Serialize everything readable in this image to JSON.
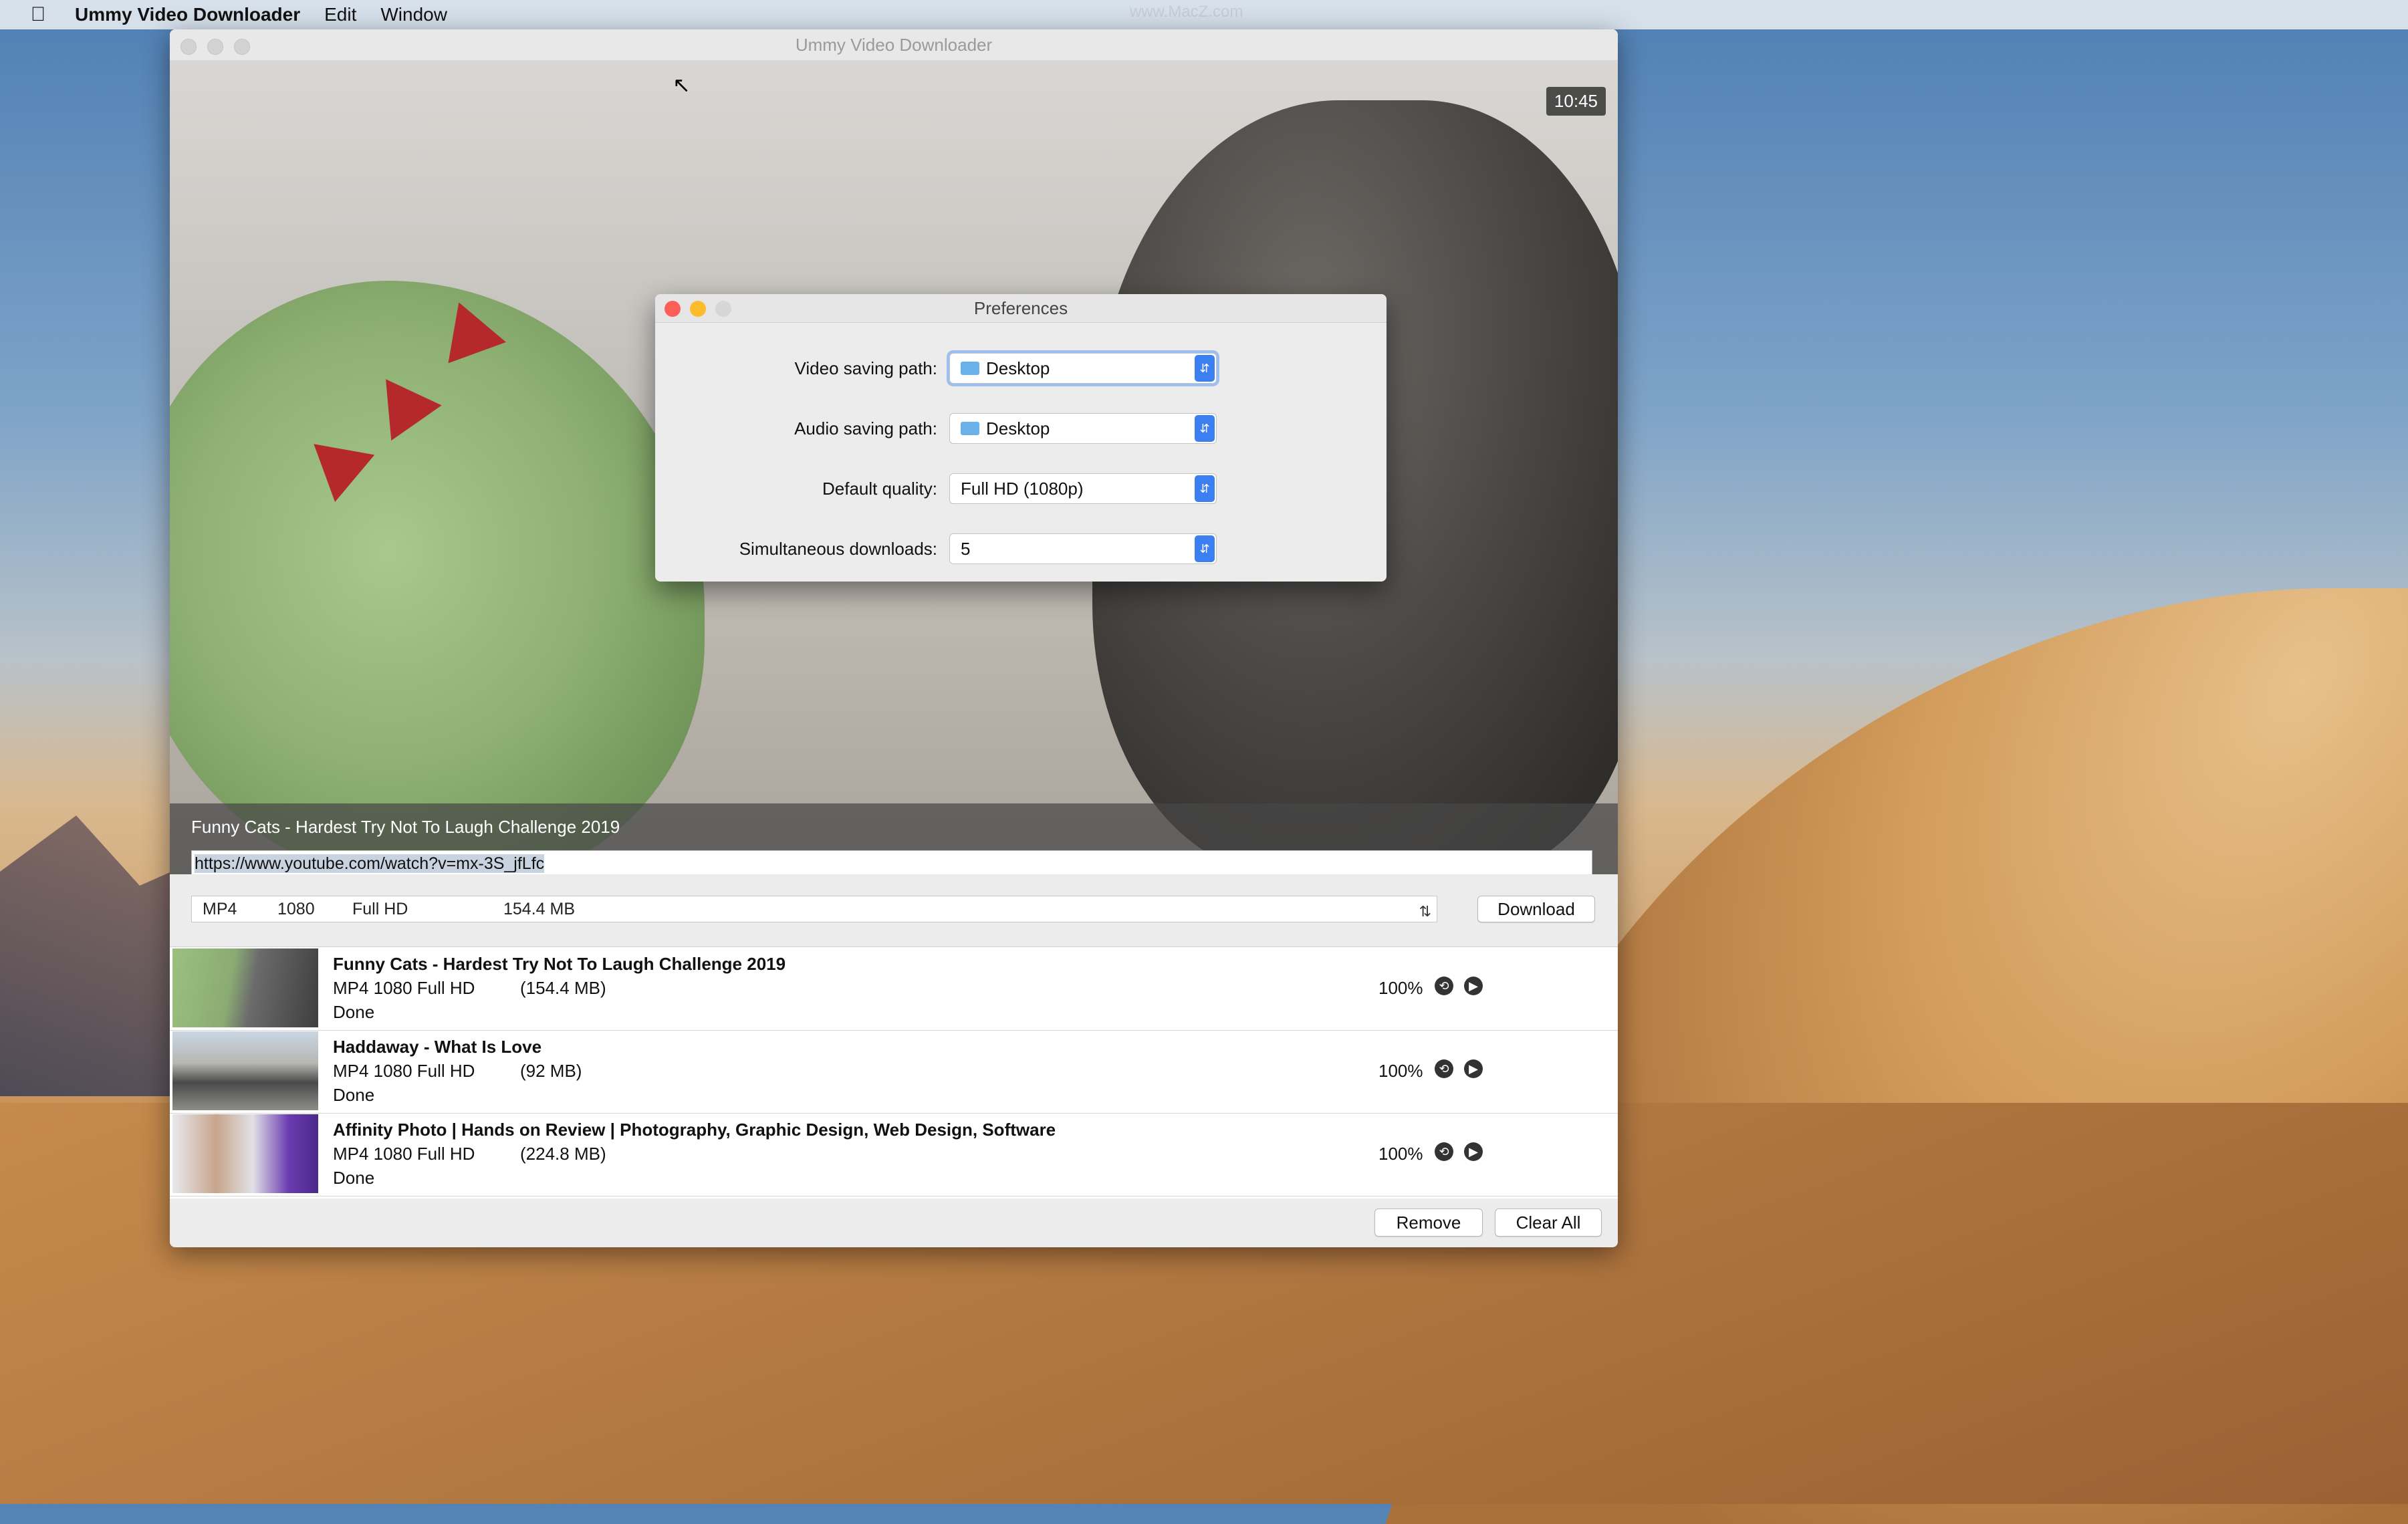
{
  "menubar": {
    "app_name": "Ummy Video Downloader",
    "items": [
      "Edit",
      "Window"
    ],
    "watermark": "www.MacZ.com"
  },
  "window": {
    "title": "Ummy Video Downloader",
    "video_time": "10:45",
    "video_title": "Funny Cats - Hardest Try Not To Laugh Challenge 2019",
    "url": "https://www.youtube.com/watch?v=mx-3S_jfLfc",
    "format": {
      "container": "MP4",
      "resolution": "1080",
      "quality": "Full HD",
      "size": "154.4 MB"
    },
    "download_label": "Download",
    "remove_label": "Remove",
    "clear_all_label": "Clear All"
  },
  "downloads": [
    {
      "title": "Funny Cats - Hardest Try Not To Laugh Challenge 2019",
      "format": "MP4 1080 Full HD",
      "size": "(154.4 MB)",
      "status": "Done",
      "progress": "100%"
    },
    {
      "title": "Haddaway - What Is Love",
      "format": "MP4 1080 Full HD",
      "size": "(92 MB)",
      "status": "Done",
      "progress": "100%"
    },
    {
      "title": "Affinity Photo | Hands on Review | Photography, Graphic Design, Web Design, Software",
      "format": "MP4 1080 Full HD",
      "size": "(224.8 MB)",
      "status": "Done",
      "progress": "100%"
    }
  ],
  "preferences": {
    "title": "Preferences",
    "video_path_label": "Video saving path:",
    "video_path_value": "Desktop",
    "audio_path_label": "Audio saving path:",
    "audio_path_value": "Desktop",
    "quality_label": "Default quality:",
    "quality_value": "Full HD (1080p)",
    "simultaneous_label": "Simultaneous downloads:",
    "simultaneous_value": "5"
  },
  "colors": {
    "accent": "#3b7ff0",
    "close": "#fc5f57",
    "minimize": "#fdbc2e"
  }
}
